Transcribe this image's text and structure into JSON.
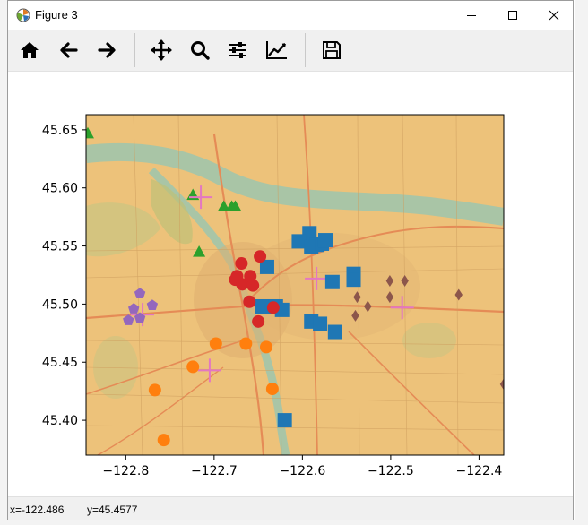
{
  "window": {
    "title": "Figure 3"
  },
  "icons": {
    "app": "matplotlib-icon",
    "minimize": "minimize-icon",
    "maximize": "maximize-icon",
    "close": "close-icon"
  },
  "toolbar": {
    "buttons": [
      {
        "name": "home",
        "icon": "home-icon"
      },
      {
        "name": "back",
        "icon": "arrow-left-icon"
      },
      {
        "name": "forward",
        "icon": "arrow-right-icon"
      },
      {
        "name": "pan",
        "icon": "move-icon"
      },
      {
        "name": "zoom",
        "icon": "magnifier-icon"
      },
      {
        "name": "subplots",
        "icon": "sliders-icon"
      },
      {
        "name": "edit-axes",
        "icon": "line-chart-icon"
      },
      {
        "name": "save",
        "icon": "floppy-disk-icon"
      }
    ]
  },
  "status": {
    "x_text": "x=-122.486",
    "y_text": "y=45.4577"
  },
  "chart_data": {
    "type": "scatter",
    "title": "",
    "xlabel": "",
    "ylabel": "",
    "xlim": [
      -122.845,
      -122.372
    ],
    "ylim": [
      45.37,
      45.663
    ],
    "xticks": [
      -122.8,
      -122.7,
      -122.6,
      -122.5,
      -122.4
    ],
    "xtick_labels": [
      "−122.8",
      "−122.7",
      "−122.6",
      "−122.5",
      "−122.4"
    ],
    "yticks": [
      45.4,
      45.45,
      45.5,
      45.55,
      45.6,
      45.65
    ],
    "ytick_labels": [
      "45.40",
      "45.45",
      "45.50",
      "45.55",
      "45.60",
      "45.65"
    ],
    "grid": false,
    "background": "street map basemap",
    "series": [
      {
        "marker": "triangle",
        "color": "#2ca02c",
        "size": 14,
        "points": [
          [
            -122.843,
            45.647
          ],
          [
            -122.724,
            45.594
          ],
          [
            -122.689,
            45.584
          ],
          [
            -122.68,
            45.584
          ],
          [
            -122.676,
            45.584
          ],
          [
            -122.717,
            45.545
          ]
        ]
      },
      {
        "marker": "plus",
        "color": "#e377c2",
        "size": 26,
        "points": [
          [
            -122.715,
            45.592
          ],
          [
            -122.584,
            45.522
          ],
          [
            -122.487,
            45.497
          ],
          [
            -122.781,
            45.491
          ],
          [
            -122.705,
            45.443
          ]
        ]
      },
      {
        "marker": "square",
        "color": "#1f77b4",
        "size": 16,
        "points": [
          [
            -122.592,
            45.561
          ],
          [
            -122.604,
            45.554
          ],
          [
            -122.584,
            45.551
          ],
          [
            -122.59,
            45.549
          ],
          [
            -122.578,
            45.552
          ],
          [
            -122.574,
            45.555
          ],
          [
            -122.64,
            45.532
          ],
          [
            -122.542,
            45.526
          ],
          [
            -122.542,
            45.521
          ],
          [
            -122.566,
            45.519
          ],
          [
            -122.646,
            45.498
          ],
          [
            -122.63,
            45.498
          ],
          [
            -122.623,
            45.495
          ],
          [
            -122.59,
            45.485
          ],
          [
            -122.58,
            45.483
          ],
          [
            -122.563,
            45.476
          ],
          [
            -122.62,
            45.4
          ]
        ]
      },
      {
        "marker": "circle",
        "color": "#d62728",
        "size": 14,
        "points": [
          [
            -122.669,
            45.535
          ],
          [
            -122.648,
            45.541
          ],
          [
            -122.674,
            45.524
          ],
          [
            -122.676,
            45.521
          ],
          [
            -122.659,
            45.524
          ],
          [
            -122.668,
            45.517
          ],
          [
            -122.656,
            45.516
          ],
          [
            -122.66,
            45.502
          ],
          [
            -122.633,
            45.497
          ],
          [
            -122.65,
            45.485
          ]
        ]
      },
      {
        "marker": "pentagon",
        "color": "#9467bd",
        "size": 13,
        "points": [
          [
            -122.784,
            45.509
          ],
          [
            -122.77,
            45.499
          ],
          [
            -122.797,
            45.486
          ],
          [
            -122.784,
            45.488
          ],
          [
            -122.791,
            45.496
          ]
        ]
      },
      {
        "marker": "diamond",
        "color": "#8c564b",
        "size": 13,
        "points": [
          [
            -122.501,
            45.52
          ],
          [
            -122.484,
            45.52
          ],
          [
            -122.538,
            45.506
          ],
          [
            -122.501,
            45.506
          ],
          [
            -122.526,
            45.498
          ],
          [
            -122.54,
            45.49
          ],
          [
            -122.423,
            45.508
          ],
          [
            -122.372,
            45.431
          ]
        ]
      },
      {
        "marker": "circle",
        "color": "#ff7f0e",
        "size": 14,
        "points": [
          [
            -122.698,
            45.466
          ],
          [
            -122.664,
            45.466
          ],
          [
            -122.641,
            45.463
          ],
          [
            -122.724,
            45.446
          ],
          [
            -122.767,
            45.426
          ],
          [
            -122.634,
            45.427
          ],
          [
            -122.757,
            45.383
          ]
        ]
      }
    ]
  }
}
